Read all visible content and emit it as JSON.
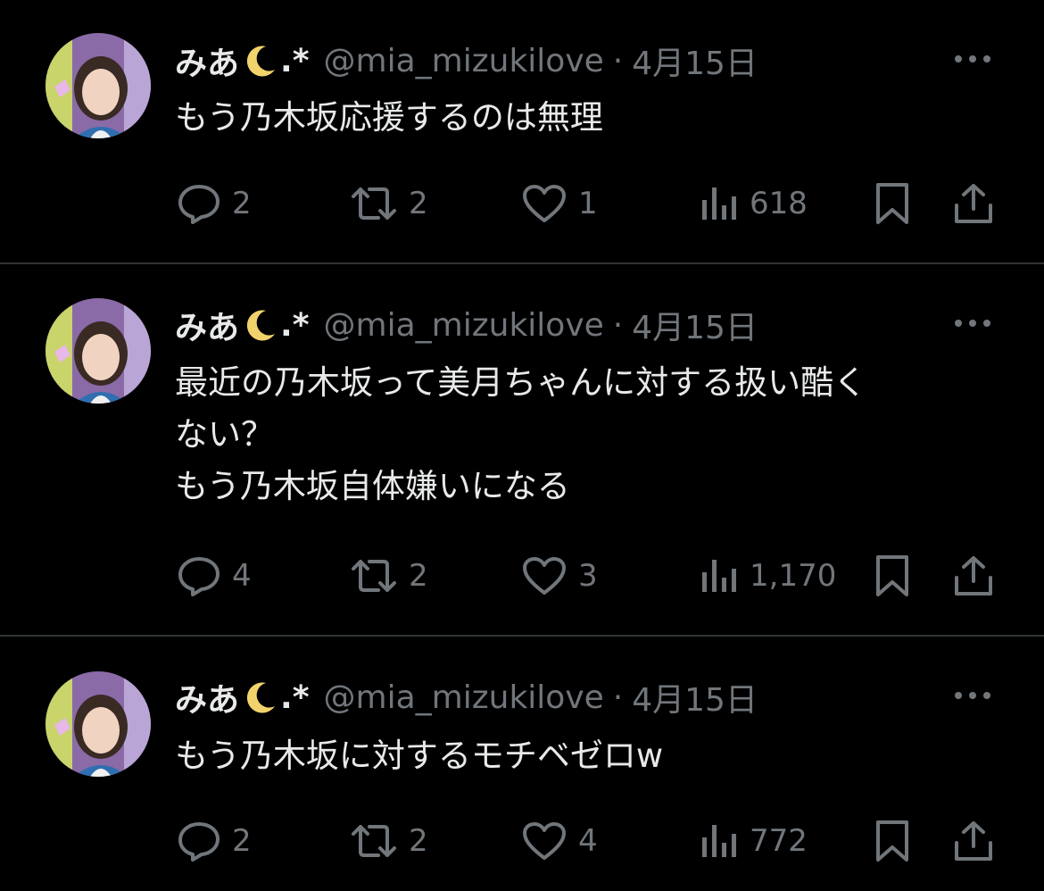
{
  "tweets": [
    {
      "display_name": "みあ",
      "name_suffix": ".*",
      "handle": "@mia_mizukilove",
      "separator": "·",
      "date": "4月15日",
      "lines": [
        "もう乃木坂応援するのは無理"
      ],
      "replies": "2",
      "retweets": "2",
      "likes": "1",
      "views": "618"
    },
    {
      "display_name": "みあ",
      "name_suffix": ".*",
      "handle": "@mia_mizukilove",
      "separator": "·",
      "date": "4月15日",
      "lines": [
        "最近の乃木坂って美月ちゃんに対する扱い酷く",
        "ない？",
        "もう乃木坂自体嫌いになる"
      ],
      "replies": "4",
      "retweets": "2",
      "likes": "3",
      "views": "1,170"
    },
    {
      "display_name": "みあ",
      "name_suffix": ".*",
      "handle": "@mia_mizukilove",
      "separator": "·",
      "date": "4月15日",
      "lines": [
        "もう乃木坂に対するモチベゼロw"
      ],
      "replies": "2",
      "retweets": "2",
      "likes": "4",
      "views": "772"
    }
  ],
  "icons": {
    "name_emoji": "crescent-moon-emoji",
    "more": "more-horizontal-icon",
    "reply": "reply-icon",
    "retweet": "retweet-icon",
    "like": "heart-icon",
    "views": "views-bar-chart-icon",
    "bookmark": "bookmark-icon",
    "share": "share-icon"
  },
  "colors": {
    "background": "#000000",
    "primary_text": "#e7e9ea",
    "secondary_text": "#71767b",
    "divider": "#2f3336",
    "moon": "#f2d36b"
  }
}
